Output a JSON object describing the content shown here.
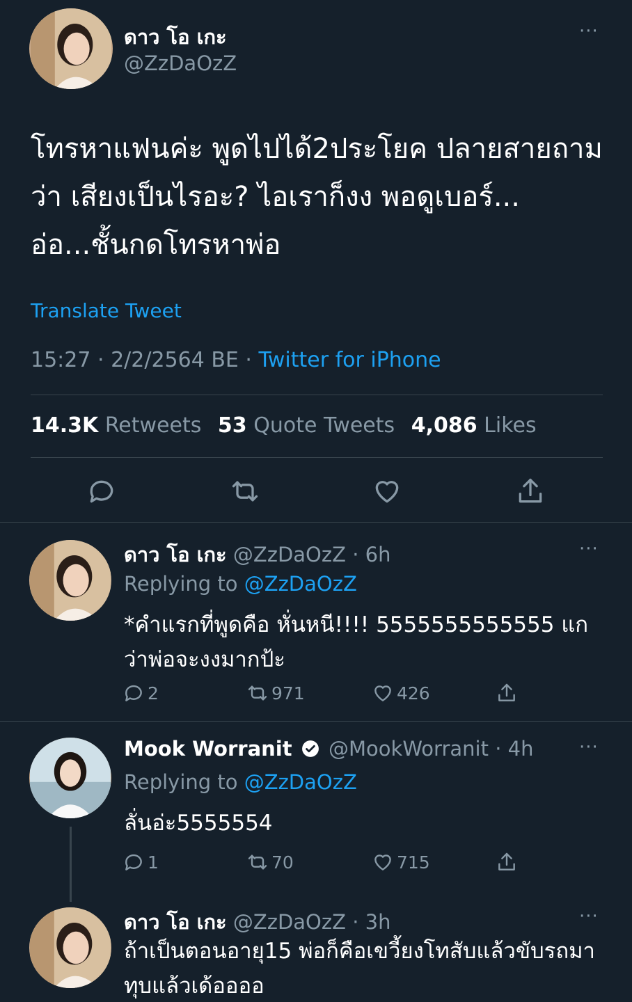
{
  "main_tweet": {
    "name": "ดาว โอ เกะ",
    "handle": "@ZzDaOzZ",
    "text": "โทรหาแฟนค่ะ พูดไปได้2ประโยค ปลายสายถามว่า เสียงเป็นไรอะ? ไอเราก็งง พอดูเบอร์... อ่อ...ชั้นกดโทรหาพ่อ",
    "translate_label": "Translate Tweet",
    "time": "15:27 · 2/2/2564 BE ·",
    "source": "Twitter for iPhone",
    "stats": {
      "retweets_count": "14.3K",
      "retweets_label": "Retweets",
      "quotes_count": "53",
      "quotes_label": "Quote Tweets",
      "likes_count": "4,086",
      "likes_label": "Likes"
    },
    "more_icon": "···"
  },
  "replies": [
    {
      "name": "ดาว โอ เกะ",
      "handle": "@ZzDaOzZ",
      "time": "· 6h",
      "replying_label": "Replying to",
      "replying_to": "@ZzDaOzZ",
      "text": "*คำแรกที่พูดคือ หั่นหนี!!!! 5555555555555 แกว่าพ่อจะงงมากป้ะ",
      "replies": "2",
      "retweets": "971",
      "likes": "426"
    },
    {
      "name": "Mook Worranit",
      "handle": "@MookWorranit",
      "time": "· 4h",
      "replying_label": "Replying to",
      "replying_to": "@ZzDaOzZ",
      "text": "ลั่นอ่ะ5555554",
      "replies": "1",
      "retweets": "70",
      "likes": "715"
    },
    {
      "name": "ดาว โอ เกะ",
      "handle": "@ZzDaOzZ",
      "time": "· 3h",
      "text": "ถ้าเป็นตอนอายุ15 พ่อก็คือเขวี้ยงโทสับแล้วขับรถมาทุบแล้วเด้ออออ"
    }
  ],
  "colors": {
    "background": "#15202b",
    "accent": "#1da1f2",
    "muted": "#8899a6",
    "divider": "#38444d"
  }
}
